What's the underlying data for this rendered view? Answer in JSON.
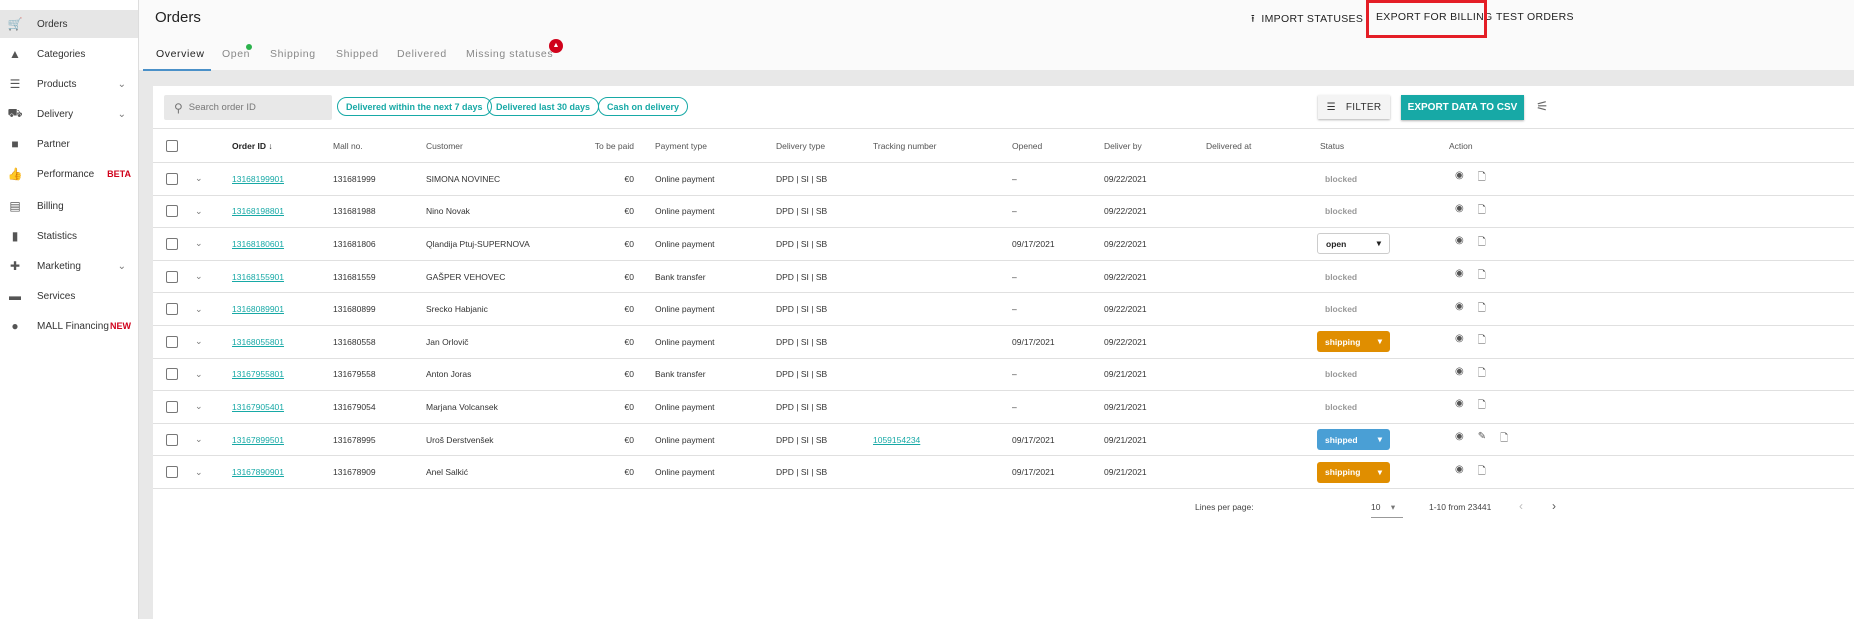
{
  "sidebar": {
    "items": [
      {
        "label": "Orders",
        "icon": "cart-icon",
        "active": true
      },
      {
        "label": "Categories",
        "icon": "shapes-icon"
      },
      {
        "label": "Products",
        "icon": "list-icon",
        "chevron": true
      },
      {
        "label": "Delivery",
        "icon": "truck-icon",
        "chevron": true
      },
      {
        "label": "Partner",
        "icon": "briefcase-icon"
      },
      {
        "label": "Performance",
        "icon": "thumb-up-icon",
        "badge": "BETA"
      },
      {
        "label": "Billing",
        "icon": "billing-icon"
      },
      {
        "label": "Statistics",
        "icon": "bar-chart-icon"
      },
      {
        "label": "Marketing",
        "icon": "marketing-icon",
        "chevron": true
      },
      {
        "label": "Services",
        "icon": "store-icon"
      },
      {
        "label": "MALL Financing",
        "icon": "financing-icon",
        "badge": "NEW"
      }
    ]
  },
  "header": {
    "title": "Orders",
    "import": "IMPORT STATUSES",
    "export_billing": "EXPORT FOR BILLING",
    "test_orders": "TEST ORDERS"
  },
  "tabs": [
    "Overview",
    "Open",
    "Shipping",
    "Shipped",
    "Delivered",
    "Missing statuses"
  ],
  "toolbar": {
    "search_placeholder": "Search order ID",
    "chips": [
      "Delivered within the next 7 days",
      "Delivered last 30 days",
      "Cash on delivery"
    ],
    "filter": "FILTER",
    "export_csv": "EXPORT DATA TO CSV"
  },
  "table": {
    "headers": [
      "Order ID",
      "Mall no.",
      "Customer",
      "To be paid",
      "Payment type",
      "Delivery type",
      "Tracking number",
      "Opened",
      "Deliver by",
      "Delivered at",
      "Status",
      "Action"
    ],
    "rows": [
      {
        "id": "13168199901",
        "mall": "131681999",
        "customer": "SIMONA NOVINEC",
        "paid": "€0",
        "payment": "Online payment",
        "delivery": "DPD | SI | SB",
        "tracking": "",
        "opened": "–",
        "deliver_by": "09/22/2021",
        "delivered_at": "",
        "status": "blocked"
      },
      {
        "id": "13168198801",
        "mall": "131681988",
        "customer": "Nino Novak",
        "paid": "€0",
        "payment": "Online payment",
        "delivery": "DPD | SI | SB",
        "tracking": "",
        "opened": "–",
        "deliver_by": "09/22/2021",
        "delivered_at": "",
        "status": "blocked"
      },
      {
        "id": "13168180601",
        "mall": "131681806",
        "customer": "Qlandija Ptuj-SUPERNOVA",
        "paid": "€0",
        "payment": "Online payment",
        "delivery": "DPD | SI | SB",
        "tracking": "",
        "opened": "09/17/2021",
        "deliver_by": "09/22/2021",
        "delivered_at": "",
        "status": "open"
      },
      {
        "id": "13168155901",
        "mall": "131681559",
        "customer": "GAŠPER VEHOVEC",
        "paid": "€0",
        "payment": "Bank transfer",
        "delivery": "DPD | SI | SB",
        "tracking": "",
        "opened": "–",
        "deliver_by": "09/22/2021",
        "delivered_at": "",
        "status": "blocked"
      },
      {
        "id": "13168089901",
        "mall": "131680899",
        "customer": "Srecko Habjanic",
        "paid": "€0",
        "payment": "Online payment",
        "delivery": "DPD | SI | SB",
        "tracking": "",
        "opened": "–",
        "deliver_by": "09/22/2021",
        "delivered_at": "",
        "status": "blocked"
      },
      {
        "id": "13168055801",
        "mall": "131680558",
        "customer": "Jan Orlovič",
        "paid": "€0",
        "payment": "Online payment",
        "delivery": "DPD | SI | SB",
        "tracking": "",
        "opened": "09/17/2021",
        "deliver_by": "09/22/2021",
        "delivered_at": "",
        "status": "shipping"
      },
      {
        "id": "13167955801",
        "mall": "131679558",
        "customer": "Anton Joras",
        "paid": "€0",
        "payment": "Bank transfer",
        "delivery": "DPD | SI | SB",
        "tracking": "",
        "opened": "–",
        "deliver_by": "09/21/2021",
        "delivered_at": "",
        "status": "blocked"
      },
      {
        "id": "13167905401",
        "mall": "131679054",
        "customer": "Marjana Volcansek",
        "paid": "€0",
        "payment": "Online payment",
        "delivery": "DPD | SI | SB",
        "tracking": "",
        "opened": "–",
        "deliver_by": "09/21/2021",
        "delivered_at": "",
        "status": "blocked"
      },
      {
        "id": "13167899501",
        "mall": "131678995",
        "customer": "Uroš Derstvenšek",
        "paid": "€0",
        "payment": "Online payment",
        "delivery": "DPD | SI | SB",
        "tracking": "1059154234",
        "opened": "09/17/2021",
        "deliver_by": "09/21/2021",
        "delivered_at": "",
        "status": "shipped",
        "editable": true
      },
      {
        "id": "13167890901",
        "mall": "131678909",
        "customer": "Anel Salkić",
        "paid": "€0",
        "payment": "Online payment",
        "delivery": "DPD | SI | SB",
        "tracking": "",
        "opened": "09/17/2021",
        "deliver_by": "09/21/2021",
        "delivered_at": "",
        "status": "shipping"
      }
    ]
  },
  "pagination": {
    "lines_label": "Lines per page:",
    "lines_value": "10",
    "range": "1-10 from 23441"
  },
  "colors": {
    "accent": "#17a9a6",
    "shipping": "#e08e00",
    "shipped": "#4a9fd5",
    "highlight": "#e41e26"
  }
}
